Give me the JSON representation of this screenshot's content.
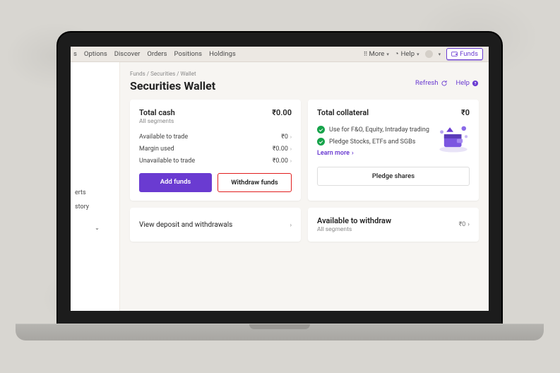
{
  "topnav": {
    "left": [
      "s",
      "Options",
      "Discover",
      "Orders",
      "Positions",
      "Holdings"
    ],
    "more": "More",
    "help": "Help",
    "user_label": "",
    "funds_btn": "Funds"
  },
  "sidebar": {
    "items": [
      "erts",
      "story"
    ]
  },
  "breadcrumb": "Funds / Securities / Wallet",
  "page_title": "Securities Wallet",
  "actions": {
    "refresh": "Refresh",
    "help": "Help"
  },
  "total_cash": {
    "title": "Total cash",
    "subtitle": "All segments",
    "value": "₹0.00",
    "rows": [
      {
        "label": "Available to trade",
        "value": "₹0"
      },
      {
        "label": "Margin used",
        "value": "₹0.00"
      },
      {
        "label": "Unavailable to trade",
        "value": "₹0.00"
      }
    ],
    "add_btn": "Add funds",
    "withdraw_btn": "Withdraw funds"
  },
  "collateral": {
    "title": "Total collateral",
    "value": "₹0",
    "features": [
      "Use for F&O, Equity, Intraday trading",
      "Pledge Stocks, ETFs and SGBs"
    ],
    "learn_more": "Learn more",
    "pledge_btn": "Pledge shares"
  },
  "view_deposits": "View deposit and withdrawals",
  "available_withdraw": {
    "title": "Available to withdraw",
    "subtitle": "All segments",
    "value": "₹0"
  }
}
